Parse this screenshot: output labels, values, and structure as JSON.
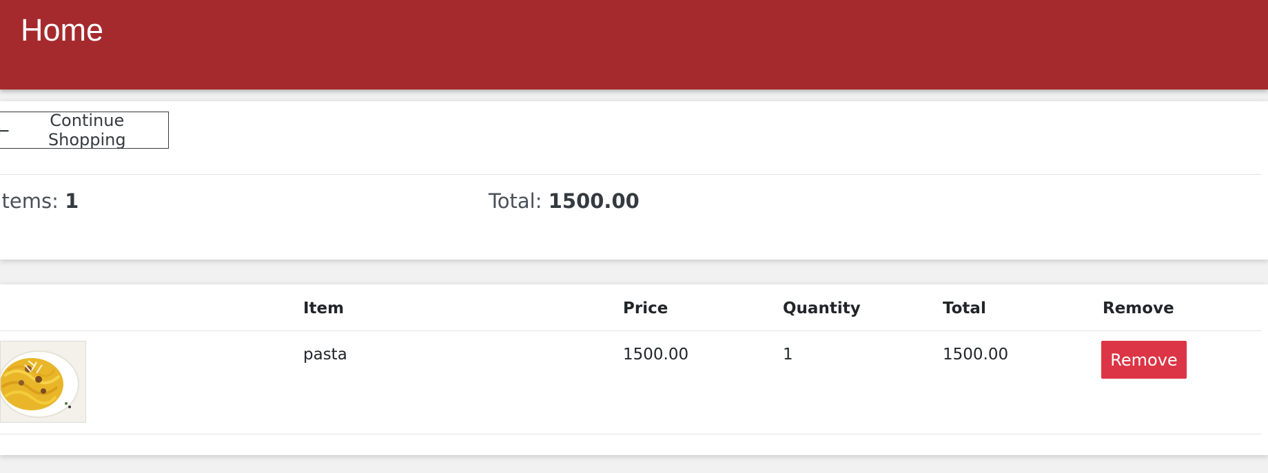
{
  "header": {
    "title": "Home",
    "background_color": "#a52a2d"
  },
  "summary": {
    "continue_button": {
      "icon": "arrow-left-icon",
      "arrow_glyph": "←",
      "label": "Continue Shopping"
    },
    "items_label": "Items:",
    "items_count": "1",
    "total_label": "Total:",
    "total_value": "1500.00"
  },
  "cart_table": {
    "headers": {
      "image": "",
      "item": "Item",
      "price": "Price",
      "quantity": "Quantity",
      "total": "Total",
      "remove": "Remove"
    },
    "rows": [
      {
        "image": "pasta-image",
        "item": "pasta",
        "price": "1500.00",
        "quantity": "1",
        "total": "1500.00",
        "remove_label": "Remove"
      }
    ]
  },
  "colors": {
    "danger": "#dc3545",
    "text_dark": "#212529"
  }
}
